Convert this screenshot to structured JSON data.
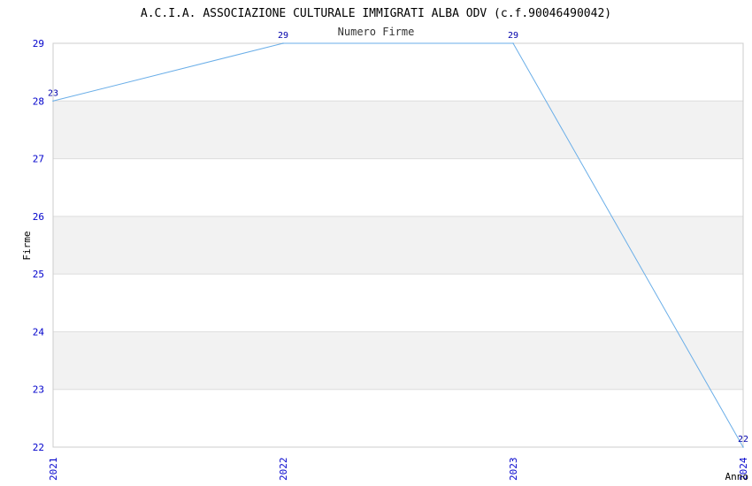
{
  "chart_data": {
    "type": "line",
    "title": "A.C.I.A. ASSOCIAZIONE CULTURALE IMMIGRATI ALBA ODV (c.f.90046490042)",
    "subtitle": "Numero Firme",
    "xlabel": "Anno",
    "ylabel": "Firme",
    "x": [
      "2021",
      "2022",
      "2023",
      "2024"
    ],
    "series": [
      {
        "values": [
          28,
          29,
          29,
          22
        ],
        "data_labels": [
          "23",
          "29",
          "29",
          "22"
        ]
      }
    ],
    "ylim": [
      22,
      29
    ],
    "yticks": [
      "22",
      "23",
      "24",
      "25",
      "26",
      "27",
      "28",
      "29"
    ],
    "grid": true,
    "legend": "none",
    "colors": {
      "line": "#6aaee8",
      "band": "#f2f2f2",
      "gridline": "#dddddd",
      "tick_text": "#0000cc",
      "data_label": "#0000aa"
    }
  }
}
